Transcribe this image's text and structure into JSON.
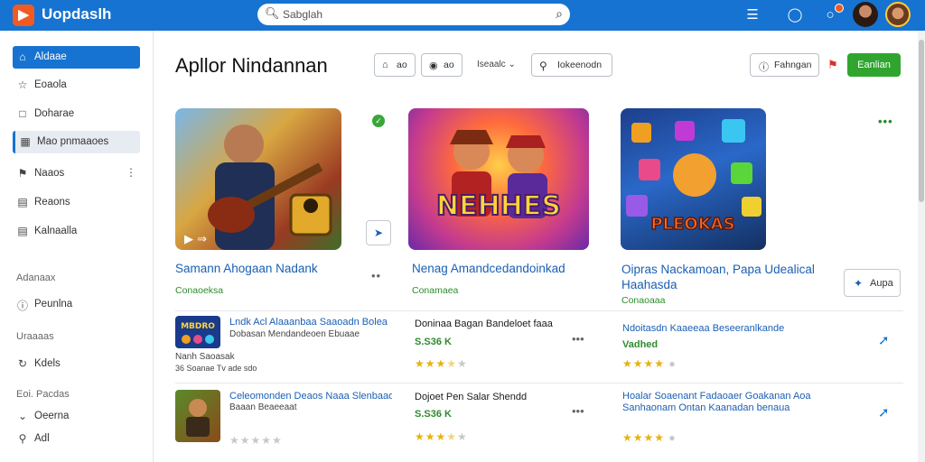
{
  "app": {
    "logo_glyph": "▶",
    "name": "Uopdaslh",
    "search_placeholder": "Sabglah",
    "brand_color": "#1673d1",
    "accent_color": "#2fa52f",
    "notif_color": "#f25a22"
  },
  "topbar_icons": [
    "menu-grid-icon",
    "chat-icon",
    "notification-icon"
  ],
  "sidebar": {
    "items": [
      {
        "icon": "home-icon",
        "label": "Aldaae",
        "state": "active"
      },
      {
        "icon": "star-icon",
        "label": "Eoaola",
        "state": ""
      },
      {
        "icon": "square-icon",
        "label": "Doharae",
        "state": ""
      },
      {
        "icon": "grid-icon",
        "label": "Mao pnmaaoes",
        "state": "selected"
      },
      {
        "icon": "flag-icon",
        "label": "Naaos",
        "state": ""
      },
      {
        "icon": "list-icon",
        "label": "Reaons",
        "state": ""
      },
      {
        "icon": "doc-icon",
        "label": "Kalnaalla",
        "state": ""
      }
    ],
    "section1": "Adanaax",
    "item_section1": {
      "icon": "info-icon",
      "label": "Peunlna"
    },
    "section2": "Uraaaas",
    "item_section2": {
      "icon": "refresh-icon",
      "label": "Kdels"
    },
    "section3": "Eoi. Pacdas",
    "item_section3": {
      "icon": "tag-icon",
      "label": "Oeerna"
    },
    "item_last": {
      "icon": "location-icon",
      "label": "Adl"
    }
  },
  "header": {
    "title": "Apllor Nindannan",
    "filter1": "ao",
    "filter2": "ao",
    "sort": "Iseaalc",
    "search_btn": "Iokeenodn",
    "action_btn": "Fahngan",
    "primary_btn": "Eanlian"
  },
  "featured": [
    {
      "title": "Samann Ahogaan Nadank",
      "sub": "Conaoeksa"
    },
    {
      "title": "Nenag Amandcedandoinkad",
      "sub": "Conamaea"
    },
    {
      "title": "Oipras Nackamoan, Papa Udealical Haahasda",
      "sub": "Conaoaaa",
      "button": "Aupa"
    }
  ],
  "rows": [
    [
      {
        "title": "Lndk Acl Alaaanbaa Saaoadn Bolea",
        "meta": "Dobasan Mendandeoen Ebuaae",
        "meta2": "Nanh Saoasak",
        "meta3": "36   Soanae   Tv  ade sdo",
        "thumb_text": "MBDRO",
        "rating": 0
      },
      {
        "title": "Doninaa Bagan Bandeloet faaa",
        "price": "S.S36 K",
        "rating": 3.5
      },
      {
        "title": "Ndoitasdn Kaaeeaa Beseeranlkande",
        "price": "Vadhed",
        "rating": 4
      }
    ],
    [
      {
        "title": "Celeomonden Deaos Naaa Slenbaao",
        "meta": "Baaan Beaeeaat",
        "rating": 0
      },
      {
        "title": "Dojoet Pen Salar Shendd",
        "price": "S.S36 K",
        "rating": 3.5
      },
      {
        "title": "Hoalar Soaenant Fadaoaer Goakanan Aoa Sanhaonam Ontan Kaanadan benaua",
        "rating": 4
      }
    ]
  ],
  "feat_img_text": [
    "",
    "NEHHES",
    "PLEOKAS"
  ]
}
